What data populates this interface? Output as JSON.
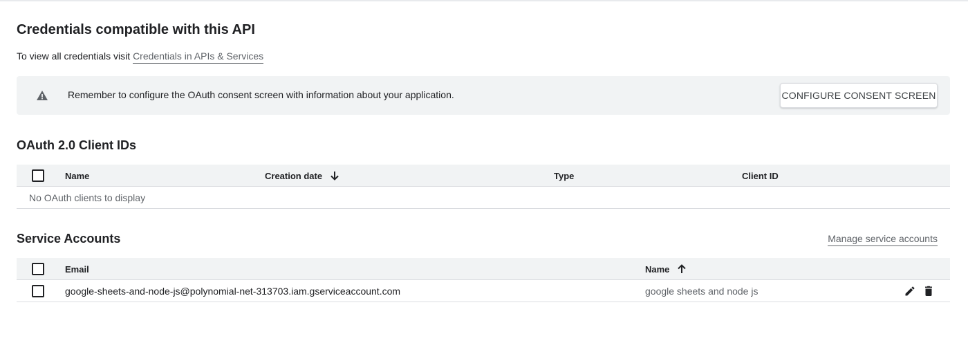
{
  "header": {
    "title": "Credentials compatible with this API",
    "subtitle_prefix": "To view all credentials visit",
    "subtitle_link": "Credentials in APIs & Services"
  },
  "banner": {
    "icon": "warning-icon",
    "text": "Remember to configure the OAuth consent screen with information about your application.",
    "button_label": "CONFIGURE CONSENT SCREEN"
  },
  "oauth": {
    "title": "OAuth 2.0 Client IDs",
    "columns": {
      "name": "Name",
      "creation_date": "Creation date",
      "type": "Type",
      "client_id": "Client ID"
    },
    "sort_icon": "arrow-downward-icon",
    "empty_message": "No OAuth clients to display"
  },
  "service_accounts": {
    "title": "Service Accounts",
    "manage_link": "Manage service accounts",
    "columns": {
      "email": "Email",
      "name": "Name"
    },
    "sort_icon": "arrow-upward-icon",
    "rows": [
      {
        "email": "google-sheets-and-node-js@polynomial-net-313703.iam.gserviceaccount.com",
        "name": "google sheets and node js",
        "actions": [
          "edit-icon",
          "delete-icon"
        ]
      }
    ]
  },
  "colors": {
    "header_bg": "#f1f3f4",
    "border": "#dadce0",
    "text": "#202124",
    "muted_text": "#5f6368",
    "warning_icon": "#5f6368"
  }
}
